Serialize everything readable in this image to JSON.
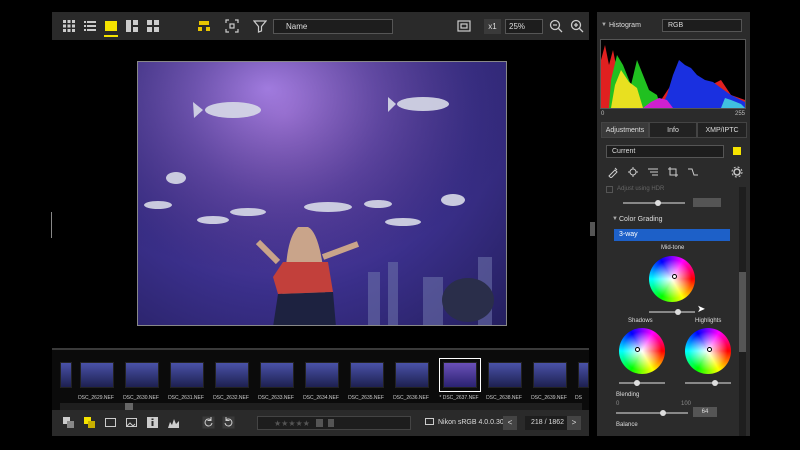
{
  "toolbar": {
    "sort_value": "Name",
    "zoom_multiplier": "x1",
    "zoom_value": "25%"
  },
  "filmstrip": {
    "thumbnails": [
      {
        "label": "DSC_2629.NEF"
      },
      {
        "label": "DSC_2630.NEF"
      },
      {
        "label": "DSC_2631.NEF"
      },
      {
        "label": "DSC_2632.NEF"
      },
      {
        "label": "DSC_2633.NEF"
      },
      {
        "label": "DSC_2634.NEF"
      },
      {
        "label": "DSC_2635.NEF"
      },
      {
        "label": "DSC_2636.NEF"
      },
      {
        "label": "* DSC_2637.NEF"
      },
      {
        "label": "DSC_2638.NEF"
      },
      {
        "label": "DSC_2639.NEF"
      },
      {
        "label": "DS"
      }
    ]
  },
  "bottombar": {
    "color_profile": "Nikon sRGB 4.0.0.3002",
    "image_count": "218 / 1862",
    "prev": "<",
    "next": ">"
  },
  "panel": {
    "histogram_title": "Histogram",
    "channel": "RGB",
    "hist_min": "0",
    "hist_max": "255",
    "tabs": [
      {
        "label": "Adjustments",
        "active": true
      },
      {
        "label": "Info",
        "active": false
      },
      {
        "label": "XMP/IPTC",
        "active": false
      }
    ],
    "preset": "Current",
    "hdr_label": "Adjust using HDR",
    "section": "Color Grading",
    "mode": "3-way",
    "midtone_label": "Mid-tone",
    "shadows_label": "Shadows",
    "highlights_label": "Highlights",
    "blending_label": "Blending",
    "blending_min": "0",
    "blending_max": "100",
    "blending_value": "64",
    "balance_label": "Balance"
  },
  "colors": {
    "accent": "#f5e300",
    "selection": "#1d60c8"
  }
}
